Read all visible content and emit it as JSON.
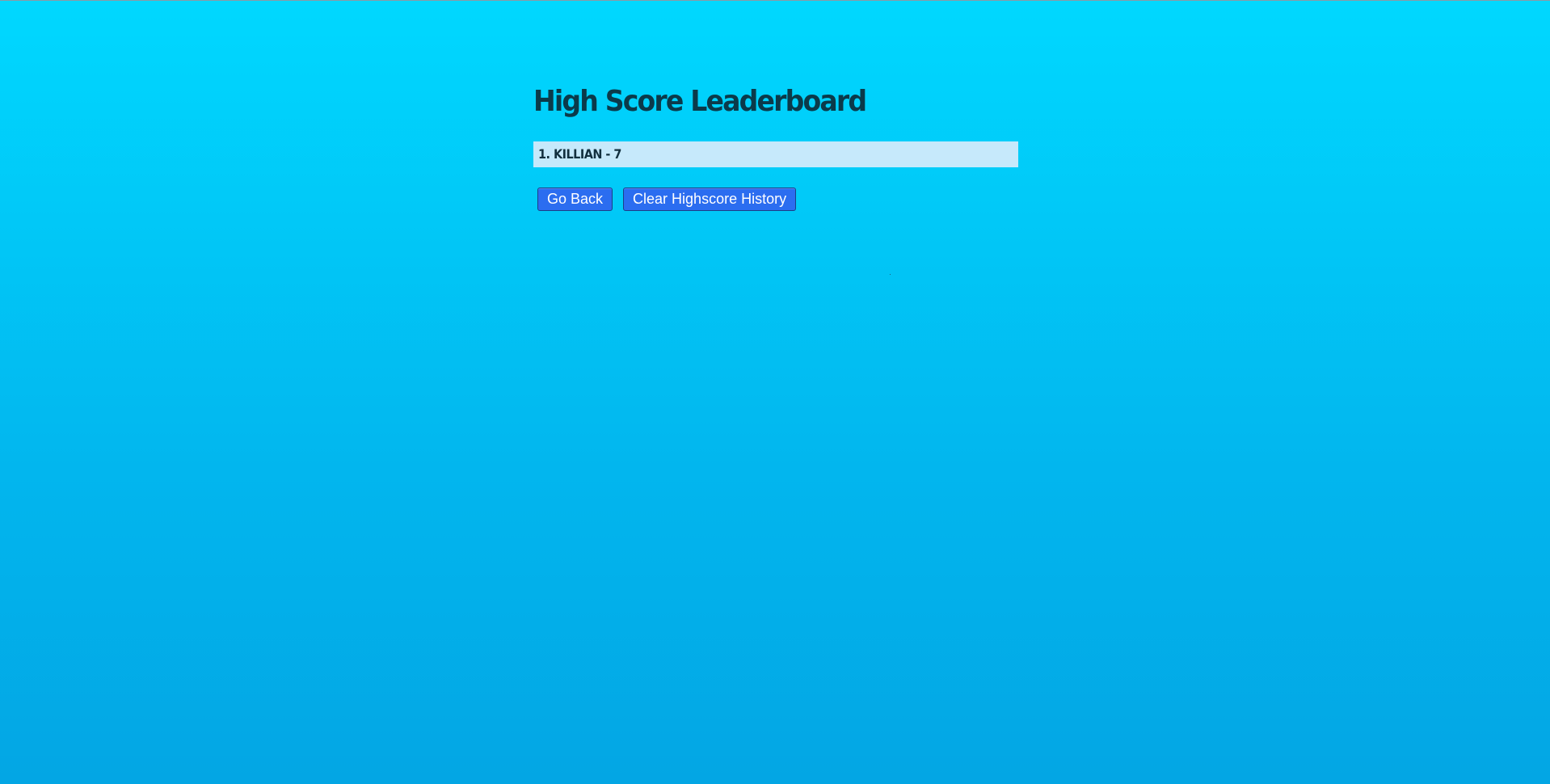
{
  "page": {
    "title": "High Score Leaderboard"
  },
  "leaderboard": {
    "entries": [
      {
        "text": "1. KILLIAN - 7"
      }
    ]
  },
  "actions": {
    "go_back_label": "Go Back",
    "clear_label": "Clear Highscore History"
  },
  "colors": {
    "background_top": "#00d8ff",
    "background_bottom": "#03a6e4",
    "title": "#0b3a4a",
    "entry_background": "#c6e9fb",
    "button": "#2b6df0"
  }
}
